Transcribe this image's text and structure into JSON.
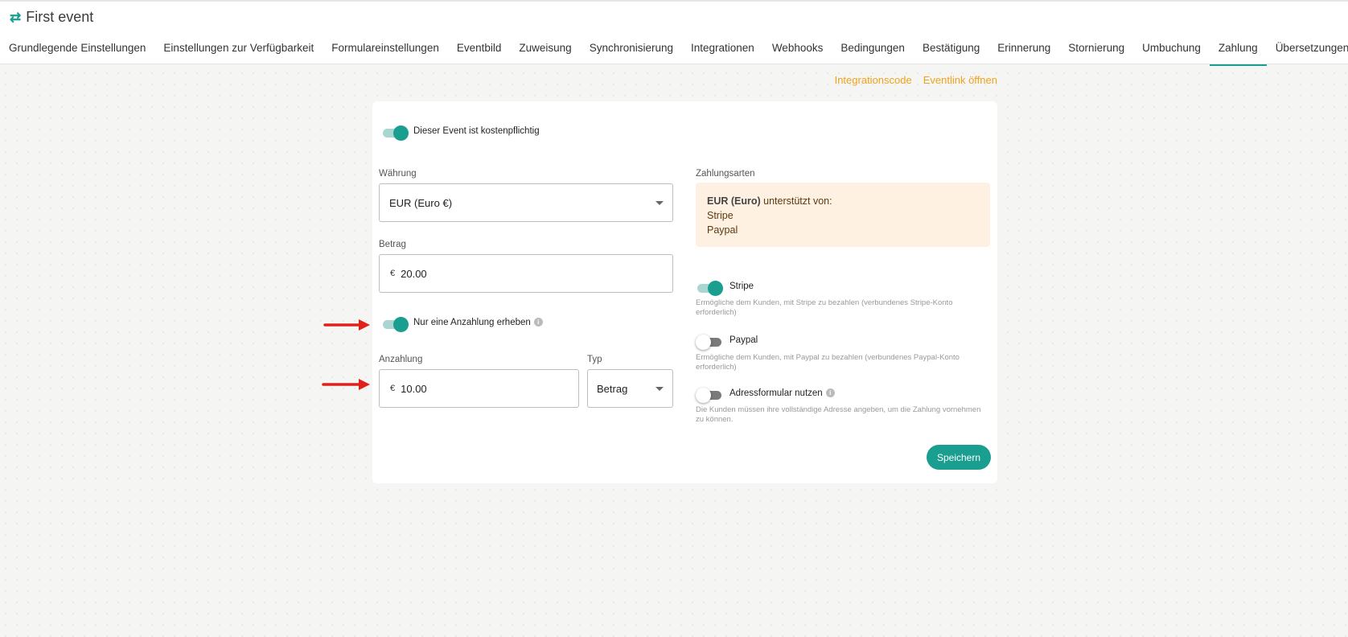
{
  "header": {
    "title": "First event",
    "tabs": [
      {
        "label": "Grundlegende Einstellungen"
      },
      {
        "label": "Einstellungen zur Verfügbarkeit"
      },
      {
        "label": "Formulareinstellungen"
      },
      {
        "label": "Eventbild"
      },
      {
        "label": "Zuweisung"
      },
      {
        "label": "Synchronisierung"
      },
      {
        "label": "Integrationen"
      },
      {
        "label": "Webhooks"
      },
      {
        "label": "Bedingungen"
      },
      {
        "label": "Bestätigung"
      },
      {
        "label": "Erinnerung"
      },
      {
        "label": "Stornierung"
      },
      {
        "label": "Umbuchung"
      },
      {
        "label": "Zahlung",
        "active": true
      },
      {
        "label": "Übersetzungen"
      }
    ]
  },
  "links": {
    "integration_code": "Integrationscode",
    "open_event_link": "Eventlink öffnen"
  },
  "form": {
    "paid_toggle": {
      "label": "Dieser Event ist kostenpflichtig",
      "on": true
    },
    "currency": {
      "label": "Währung",
      "value": "EUR (Euro €)"
    },
    "amount": {
      "label": "Betrag",
      "currency_symbol": "€",
      "value": "20.00"
    },
    "deposit_toggle": {
      "label": "Nur eine Anzahlung erheben",
      "on": true
    },
    "deposit": {
      "label": "Anzahlung",
      "currency_symbol": "€",
      "value": "10.00"
    },
    "type": {
      "label": "Typ",
      "value": "Betrag"
    },
    "payment_methods": {
      "label": "Zahlungsarten",
      "notice_bold": "EUR (Euro)",
      "notice_text": " unterstützt von:",
      "notice_items": [
        "Stripe",
        "Paypal"
      ]
    },
    "stripe": {
      "label": "Stripe",
      "on": true,
      "description": "Ermögliche dem Kunden, mit Stripe zu bezahlen (verbundenes Stripe-Konto erforderlich)"
    },
    "paypal": {
      "label": "Paypal",
      "on": false,
      "description": "Ermögliche dem Kunden, mit Paypal zu bezahlen (verbundenes Paypal-Konto erforderlich)"
    },
    "address_form": {
      "label": "Adressformular nutzen",
      "on": false,
      "description": "Die Kunden müssen ihre vollständige Adresse angeben, um die Zahlung vornehmen zu können."
    },
    "save_label": "Speichern"
  },
  "colors": {
    "accent": "#1a9e8f",
    "link": "#f0a21c",
    "notice_bg": "#fff1e2",
    "arrow": "#e0201b"
  }
}
